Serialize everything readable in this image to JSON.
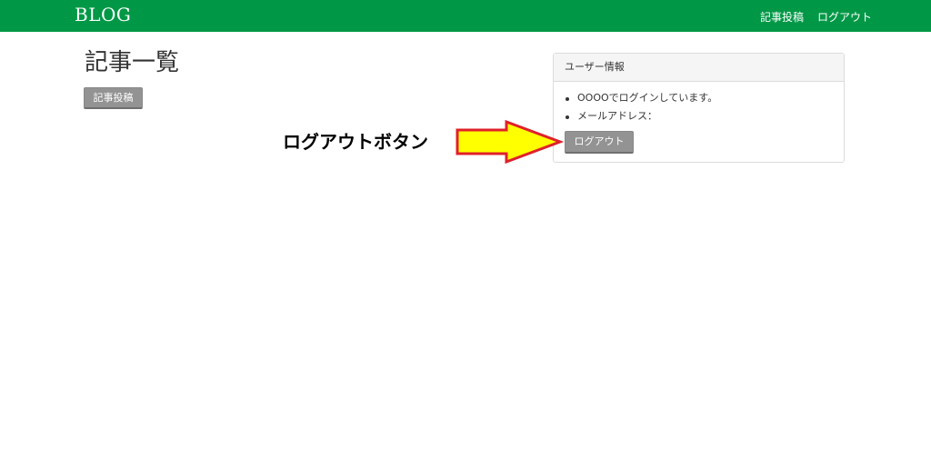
{
  "navbar": {
    "brand": "BLOG",
    "links": [
      "記事投稿",
      "ログアウト"
    ],
    "bg_color": "#009846"
  },
  "main": {
    "title": "記事一覧",
    "post_button": "記事投稿"
  },
  "user_panel": {
    "heading": "ユーザー情報",
    "items": [
      "OOOOでログインしています。",
      "メールアドレス："
    ],
    "logout_button": "ログアウト"
  },
  "annotation": {
    "label": "ログアウトボタン",
    "arrow_fill": "#ffff00",
    "arrow_stroke": "#e0202a",
    "icon": "right-arrow-icon"
  }
}
